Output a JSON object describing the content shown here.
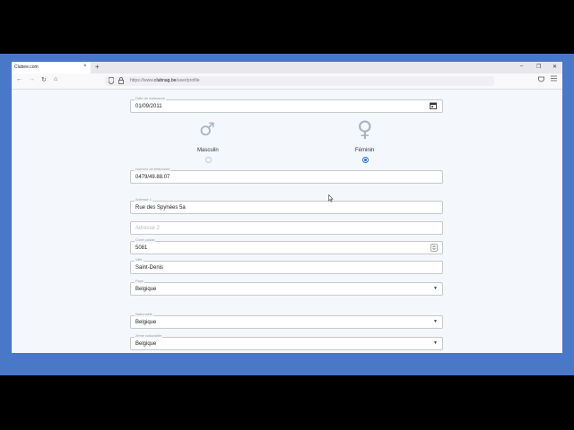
{
  "browser": {
    "tab_title": "Clubee.com",
    "tab_close": "×",
    "new_tab": "+",
    "url_prefix": "https://www.",
    "url_domain": "clubnag.be",
    "url_path": "/user/profile",
    "nav": {
      "back": "←",
      "forward": "→",
      "reload": "↻",
      "home": "⌂"
    },
    "star": "☆",
    "window_controls": {
      "minimize": "–",
      "restore": "❐",
      "close": "✕"
    }
  },
  "form": {
    "birthdate": {
      "label": "Date de naissance",
      "value": "01/09/2011",
      "icon": "calendar-icon"
    },
    "gender": {
      "male": {
        "symbol": "♂",
        "label": "Masculin",
        "selected": false
      },
      "female": {
        "symbol": "♀",
        "label": "Féminin",
        "selected": true
      }
    },
    "phone": {
      "label": "Numéro de téléphone",
      "value": "0479/49.88.07"
    },
    "address1": {
      "label": "Adresse 1",
      "value": "Rue des Spynées 5a"
    },
    "address2": {
      "placeholder": "Adresse 2"
    },
    "postal_code": {
      "label": "Code postal",
      "value": "5081"
    },
    "city": {
      "label": "Ville",
      "value": "Saint-Denis"
    },
    "country": {
      "label": "Pays",
      "value": "Belgique"
    },
    "nationality": {
      "label": "Nationalité",
      "value": "Belgique"
    },
    "second_nationality": {
      "label": "2ème nationalité",
      "value": "Belgique"
    }
  },
  "colors": {
    "page_bg": "#4a78c8",
    "form_bg": "#f4f8fc",
    "radio_selected": "#1e6fd8"
  }
}
